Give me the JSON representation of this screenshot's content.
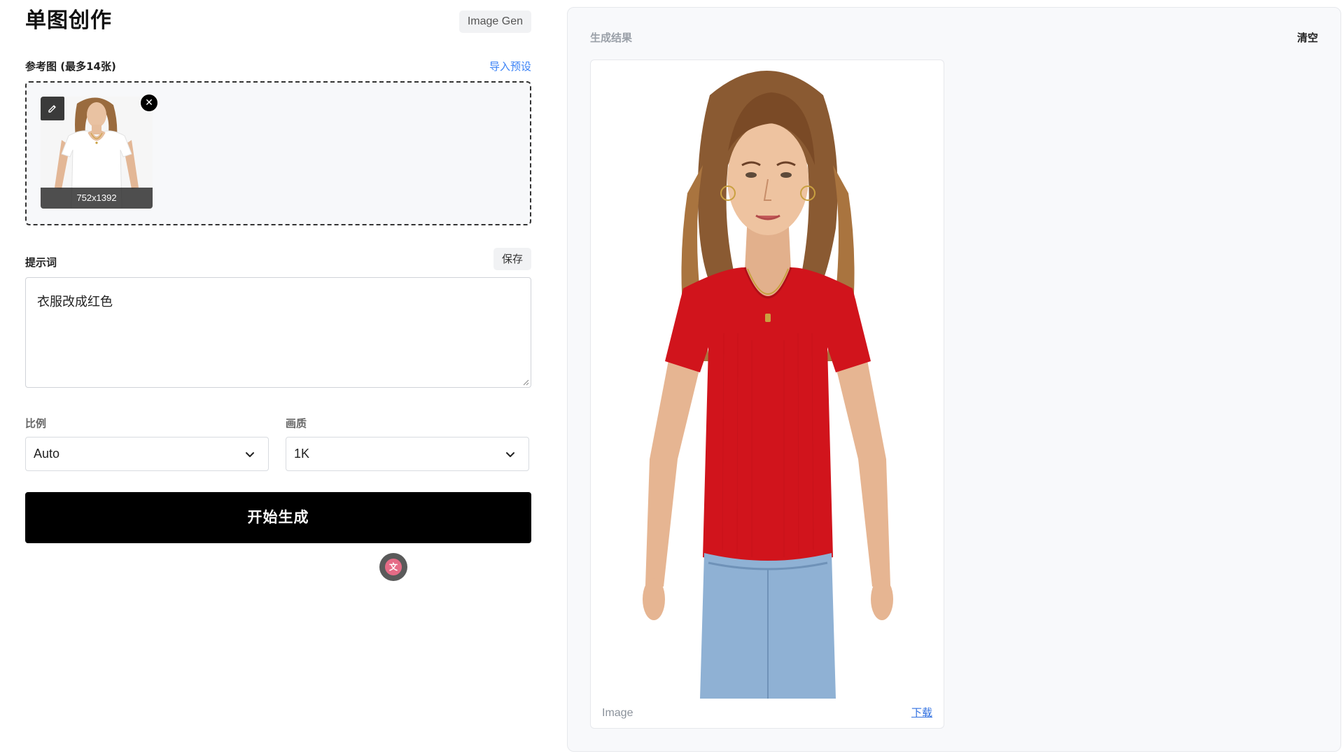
{
  "header": {
    "title": "单图创作",
    "mode_badge": "Image Gen"
  },
  "reference": {
    "label": "参考图 (最多14张)",
    "import_link": "导入预设",
    "thumbnail": {
      "size_text": "752x1392"
    }
  },
  "prompt": {
    "label": "提示词",
    "save_label": "保存",
    "value": "衣服改成红色"
  },
  "options": {
    "ratio": {
      "label": "比例",
      "value": "Auto"
    },
    "quality": {
      "label": "画质",
      "value": "1K"
    }
  },
  "generate": {
    "label": "开始生成"
  },
  "result": {
    "title": "生成结果",
    "clear_label": "清空",
    "card": {
      "caption": "Image",
      "download_label": "下载"
    }
  },
  "colors": {
    "primary_button": "#000000",
    "link": "#3b82f6",
    "shirt_reference": "#ffffff",
    "shirt_result": "#d1141c"
  },
  "icons": {
    "edit": "pencil-icon",
    "remove": "close-icon",
    "chevron": "chevron-down-icon",
    "translate": "translate-icon"
  }
}
